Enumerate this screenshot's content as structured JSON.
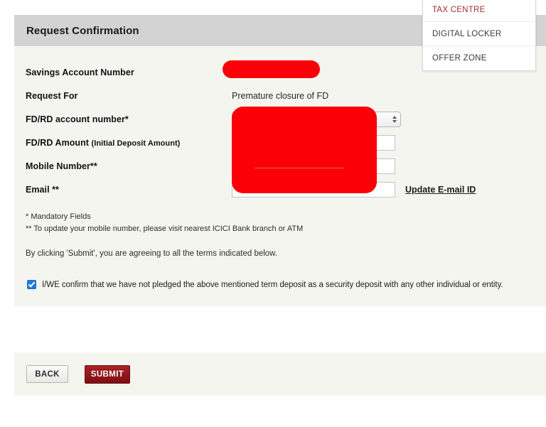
{
  "card": {
    "header_title": "Request Confirmation"
  },
  "form": {
    "rows": [
      {
        "label": "Savings Account Number",
        "type": "redacted-pill",
        "value": ""
      },
      {
        "label": "Request For",
        "type": "static",
        "value": "Premature closure of FD"
      },
      {
        "label": "FD/RD account number*",
        "type": "select",
        "value": "",
        "options": [
          ""
        ]
      },
      {
        "label": "FD/RD Amount ",
        "label_sub": "(Initial Deposit Amount)",
        "type": "text",
        "value": "",
        "placeholder": ""
      },
      {
        "label": "Mobile Number**",
        "type": "text",
        "value": "",
        "placeholder": ""
      },
      {
        "label": "Email **",
        "type": "text",
        "value": "",
        "placeholder": "",
        "link_label": "Update E-mail ID"
      }
    ]
  },
  "notes": {
    "mandatory": "* Mandatory Fields",
    "mobile": "** To update your mobile number, please visit nearest ICICI Bank branch or ATM",
    "agree": "By clicking 'Submit', you are agreeing to all the terms indicated below."
  },
  "consent": {
    "checked": true,
    "text": "I/WE confirm that we have not pledged the above mentioned term deposit as a security deposit with any other individual or entity."
  },
  "buttons": {
    "back": "BACK",
    "submit": "SUBMIT"
  },
  "menu": {
    "items": [
      {
        "label": "TAX CENTRE",
        "active": true
      },
      {
        "label": "DIGITAL LOCKER",
        "active": false
      },
      {
        "label": "OFFER ZONE",
        "active": false
      }
    ]
  },
  "colors": {
    "header_band": "#d3d3d3",
    "panel_bg": "#f5f5f0",
    "submit_red_top": "#ad2023",
    "submit_red_bottom": "#7c0e13",
    "redaction": "#fb0007",
    "menu_active": "#a1312f",
    "checkbox_blue": "#1f7ae0"
  }
}
